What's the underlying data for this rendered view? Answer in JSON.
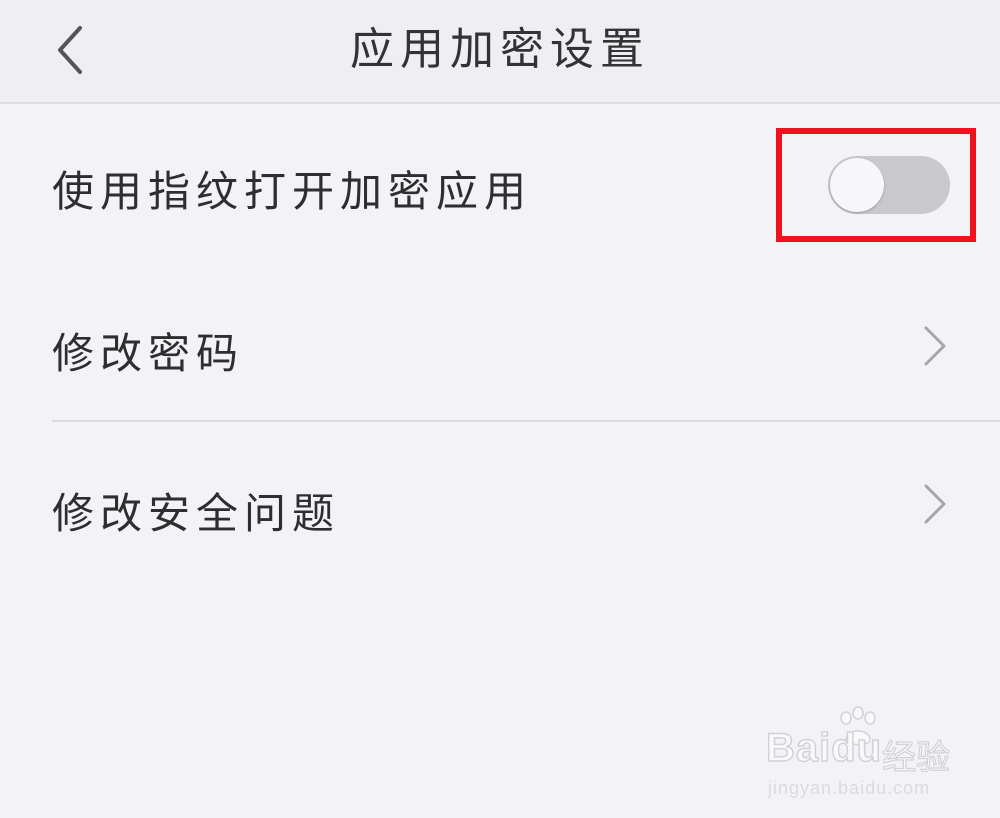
{
  "header": {
    "title": "应用加密设置",
    "back_icon": "chevron-left-icon"
  },
  "settings": {
    "fingerprint": {
      "label": "使用指纹打开加密应用",
      "enabled": false
    },
    "change_password": {
      "label": "修改密码",
      "icon": "chevron-right-icon"
    },
    "change_security_question": {
      "label": "修改安全问题",
      "icon": "chevron-right-icon"
    }
  },
  "annotation": {
    "color": "#f0111f"
  },
  "watermark": {
    "brand": "Baidu",
    "brand_cn": "经验",
    "url": "jingyan.baidu.com"
  },
  "colors": {
    "background": "#f3f2f6",
    "header_bg": "#efeef2",
    "toggle_off": "#c9c9cc",
    "divider": "#dcdbe0"
  }
}
